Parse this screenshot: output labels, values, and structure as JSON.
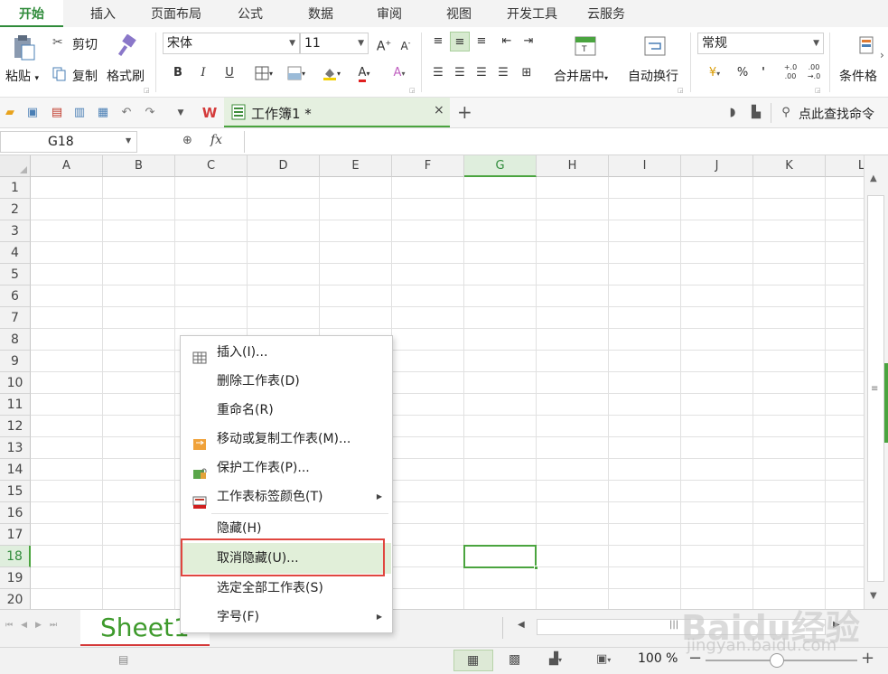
{
  "tabs": [
    "开始",
    "插入",
    "页面布局",
    "公式",
    "数据",
    "审阅",
    "视图",
    "开发工具",
    "云服务"
  ],
  "ribbon": {
    "paste": "粘贴",
    "cut": "剪切",
    "copy": "复制",
    "format_painter": "格式刷",
    "font_name": "宋体",
    "font_size": "11",
    "bold": "B",
    "italic": "I",
    "underline": "U",
    "merge_center": "合并居中",
    "wrap_text": "自动换行",
    "number_format": "常规",
    "percent": "%",
    "comma": "'",
    "conditional": "条件格"
  },
  "document": {
    "tab_title": "工作簿1 *",
    "search_label": "点此查找命令"
  },
  "formula_bar": {
    "name_box": "G18",
    "fx": "fx",
    "formula": ""
  },
  "grid": {
    "columns": [
      "A",
      "B",
      "C",
      "D",
      "E",
      "F",
      "G",
      "H",
      "I",
      "J",
      "K",
      "L"
    ],
    "rows": [
      "1",
      "2",
      "3",
      "4",
      "5",
      "6",
      "7",
      "8",
      "9",
      "10",
      "11",
      "12",
      "13",
      "14",
      "15",
      "16",
      "17",
      "18",
      "19",
      "20"
    ],
    "selected_cell": "G18"
  },
  "context_menu": {
    "items": [
      {
        "label": "插入(I)...",
        "icon": "table-icon"
      },
      {
        "label": "删除工作表(D)",
        "icon": ""
      },
      {
        "label": "重命名(R)",
        "icon": ""
      },
      {
        "label": "移动或复制工作表(M)...",
        "icon": "move-copy-icon"
      },
      {
        "label": "保护工作表(P)...",
        "icon": "lock-icon"
      },
      {
        "label": "工作表标签颜色(T)",
        "icon": "tab-color-icon"
      },
      {
        "label": "隐藏(H)",
        "icon": ""
      },
      {
        "label": "取消隐藏(U)...",
        "icon": ""
      },
      {
        "label": "选定全部工作表(S)",
        "icon": ""
      },
      {
        "label": "字号(F)",
        "icon": ""
      }
    ]
  },
  "sheet_tab": "Sheet1",
  "status": {
    "zoom": "100 %"
  },
  "watermark": {
    "brand": "Baidu经验",
    "url": "jingyan.baidu.com"
  },
  "colors": {
    "accent": "#2f8b3a",
    "highlight_box": "#e0463f",
    "menu_highlight": "#e1efd9"
  }
}
